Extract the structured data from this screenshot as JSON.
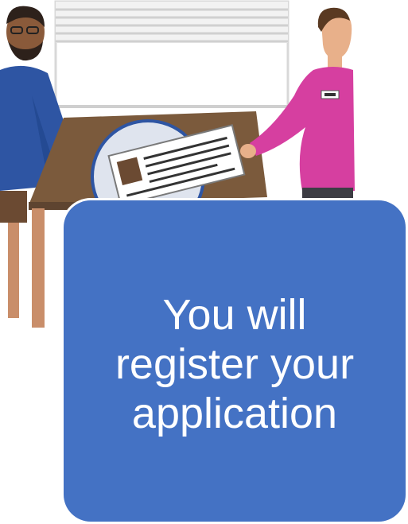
{
  "callout": {
    "text": "You will\nregister your\napplication"
  },
  "illustration": {
    "scene": "registration-meeting",
    "icons": [
      "person-left-icon",
      "person-right-icon",
      "desk-icon",
      "document-magnifier-icon",
      "window-blinds-icon"
    ]
  },
  "colors": {
    "card": "#4472c4",
    "card_text": "#ffffff",
    "desk": "#7b5a3c",
    "left_shirt": "#2e55a3",
    "right_shirt": "#d63fa0",
    "window_frame": "#d8d8d8"
  }
}
